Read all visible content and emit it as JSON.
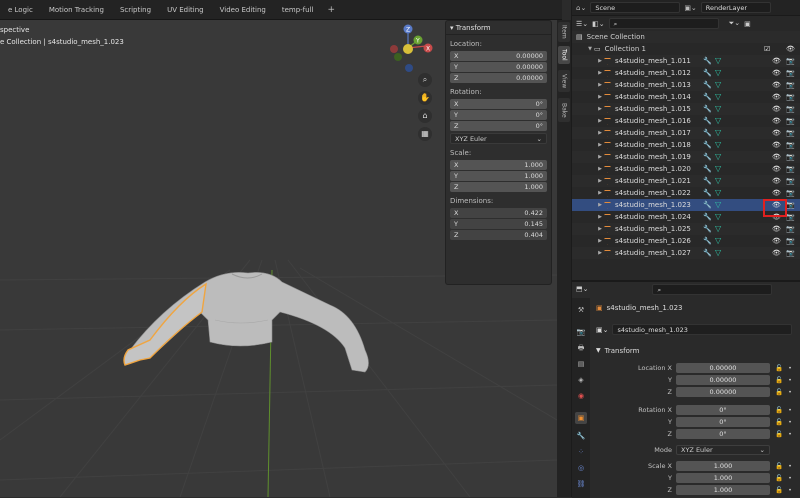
{
  "topbar": {
    "tabs": [
      "e Logic",
      "Motion Tracking",
      "Scripting",
      "UV Editing",
      "Video Editing",
      "temp-full"
    ],
    "plus": "+"
  },
  "viewport": {
    "title_line1": "spective",
    "title_line2": "e Collection | s4studio_mesh_1.023"
  },
  "gizmo": {
    "z": "Z",
    "y": "Y",
    "x": "X"
  },
  "npanel": {
    "header": "Transform",
    "location_label": "Location:",
    "location": [
      {
        "axis": "X",
        "value": "0.00000"
      },
      {
        "axis": "Y",
        "value": "0.00000"
      },
      {
        "axis": "Z",
        "value": "0.00000"
      }
    ],
    "rotation_label": "Rotation:",
    "rotation": [
      {
        "axis": "X",
        "value": "0°"
      },
      {
        "axis": "Y",
        "value": "0°"
      },
      {
        "axis": "Z",
        "value": "0°"
      }
    ],
    "rotation_mode": "XYZ Euler",
    "scale_label": "Scale:",
    "scale": [
      {
        "axis": "X",
        "value": "1.000"
      },
      {
        "axis": "Y",
        "value": "1.000"
      },
      {
        "axis": "Z",
        "value": "1.000"
      }
    ],
    "dimensions_label": "Dimensions:",
    "dimensions": [
      {
        "axis": "X",
        "value": "0.422"
      },
      {
        "axis": "Y",
        "value": "0.145"
      },
      {
        "axis": "Z",
        "value": "0.404"
      }
    ]
  },
  "vtabs": [
    "Item",
    "Tool",
    "View",
    "Bake"
  ],
  "outliner": {
    "scene": "Scene",
    "render_layer": "RenderLayer",
    "scene_collection": "Scene Collection",
    "collection": "Collection 1",
    "objects": [
      "s4studio_mesh_1.011",
      "s4studio_mesh_1.012",
      "s4studio_mesh_1.013",
      "s4studio_mesh_1.014",
      "s4studio_mesh_1.015",
      "s4studio_mesh_1.016",
      "s4studio_mesh_1.017",
      "s4studio_mesh_1.018",
      "s4studio_mesh_1.019",
      "s4studio_mesh_1.020",
      "s4studio_mesh_1.021",
      "s4studio_mesh_1.022",
      "s4studio_mesh_1.023",
      "s4studio_mesh_1.024",
      "s4studio_mesh_1.025",
      "s4studio_mesh_1.026",
      "s4studio_mesh_1.027"
    ],
    "selected_index": 12
  },
  "properties": {
    "object_name": "s4studio_mesh_1.023",
    "object_name_field": "s4studio_mesh_1.023",
    "section": "Transform",
    "location": [
      {
        "label": "Location X",
        "value": "0.00000"
      },
      {
        "label": "Y",
        "value": "0.00000"
      },
      {
        "label": "Z",
        "value": "0.00000"
      }
    ],
    "rotation": [
      {
        "label": "Rotation X",
        "value": "0°"
      },
      {
        "label": "Y",
        "value": "0°"
      },
      {
        "label": "Z",
        "value": "0°"
      }
    ],
    "mode_label": "Mode",
    "mode_value": "XYZ Euler",
    "scale": [
      {
        "label": "Scale X",
        "value": "1.000"
      },
      {
        "label": "Y",
        "value": "1.000"
      },
      {
        "label": "Z",
        "value": "1.000"
      }
    ]
  },
  "colors": {
    "accent": "#334d80",
    "highlight": "#e02020",
    "object_orange": "#e38b3b",
    "mesh_teal": "#2fc2a5"
  }
}
